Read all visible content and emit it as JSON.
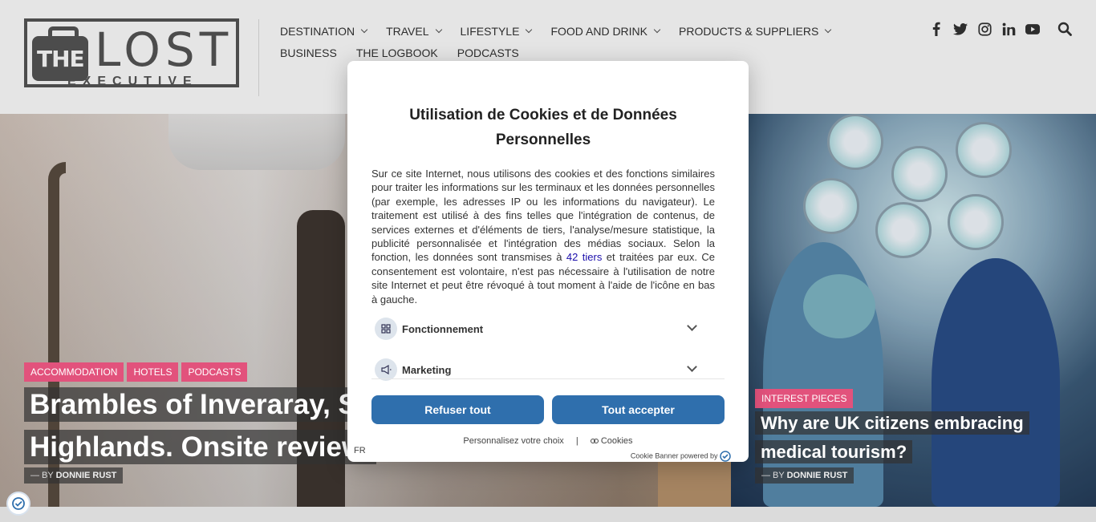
{
  "logo": {
    "the": "THE",
    "lost": "LOST",
    "executive": "EXECUTIVE"
  },
  "nav": {
    "row1": [
      {
        "label": "DESTINATION",
        "dropdown": true
      },
      {
        "label": "TRAVEL",
        "dropdown": true
      },
      {
        "label": "LIFESTYLE",
        "dropdown": true
      },
      {
        "label": "FOOD AND DRINK",
        "dropdown": true
      },
      {
        "label": "PRODUCTS & SUPPLIERS",
        "dropdown": true
      }
    ],
    "row2": [
      {
        "label": "BUSINESS"
      },
      {
        "label": "THE LOGBOOK"
      },
      {
        "label": "PODCASTS"
      }
    ]
  },
  "social": [
    "facebook-icon",
    "twitter-icon",
    "instagram-icon",
    "linkedin-icon",
    "youtube-icon"
  ],
  "hero_left": {
    "tags": [
      "ACCOMMODATION",
      "HOTELS",
      "PODCASTS"
    ],
    "title_line1": "Brambles of Inveraray, Sco",
    "title_line2": "Highlands. Onsite review.",
    "by_prefix": "— BY",
    "author": "DONNIE RUST"
  },
  "hero_right": {
    "tags": [
      "INTEREST PIECES"
    ],
    "title_line1": "Why are UK citizens embracing",
    "title_line2": "medical tourism?",
    "by_prefix": "— BY",
    "author": "DONNIE RUST"
  },
  "cookie": {
    "title": "Utilisation de Cookies et de Données Personnelles",
    "desc_before": "Sur ce site Internet, nous utilisons des cookies et des fonctions similaires pour traiter les informations sur les terminaux et les données personnelles (par exemple, les adresses IP ou les informations du navigateur). Le traitement est utilisé à des fins telles que l'intégration de contenus, de services externes et d'éléments de tiers, l'analyse/mesure statistique, la publicité personnalisée et l'intégration des médias sociaux. Selon la fonction, les données sont transmises à ",
    "third_link": "42 tiers",
    "desc_after": " et traitées par eux. Ce consentement est volontaire, n'est pas nécessaire à l'utilisation de notre site Internet et peut être révoqué à tout moment à l'aide de l'icône en bas à gauche.",
    "categories": [
      "Fonctionnement",
      "Marketing"
    ],
    "reject": "Refuser tout",
    "accept": "Tout accepter",
    "customize": "Personnalisez votre choix",
    "pipe": "|",
    "cookies": "Cookies",
    "lang": "FR",
    "powered": "Cookie Banner powered by"
  },
  "colors": {
    "tag": "#e2527c",
    "button": "#2f6fad"
  }
}
